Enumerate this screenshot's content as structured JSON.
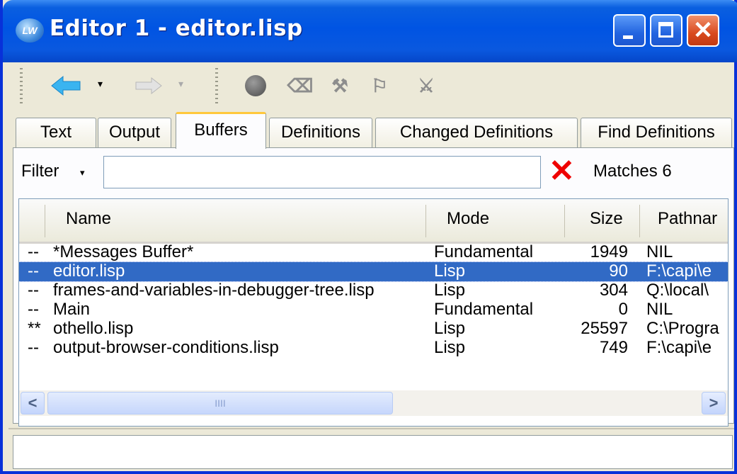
{
  "window": {
    "title": "Editor 1 - editor.lisp",
    "app_icon": "LW",
    "controls": [
      "minimize-icon",
      "maximize-icon",
      "close-icon"
    ]
  },
  "toolbar": {
    "back_icon": "⇦",
    "forward_icon": "⇨",
    "dropdown_glyph": "▾",
    "tool2": "⌫",
    "tool3": "⚒",
    "tool4": "⚐",
    "tool5": "⚔"
  },
  "tabs": [
    {
      "label": "Text"
    },
    {
      "label": "Output"
    },
    {
      "label": "Buffers",
      "active": true
    },
    {
      "label": "Definitions"
    },
    {
      "label": "Changed Definitions"
    },
    {
      "label": "Find Definitions"
    }
  ],
  "filter": {
    "label": "Filter",
    "caret": "▾",
    "value": "",
    "clear_glyph": "✕",
    "matches": "Matches 6"
  },
  "columns": [
    "Name",
    "Mode",
    "Size",
    "Pathnar"
  ],
  "rows": [
    {
      "flag": "--",
      "name": "*Messages Buffer*",
      "mode": "Fundamental",
      "size": "1949",
      "path": "NIL"
    },
    {
      "flag": "--",
      "name": "editor.lisp",
      "mode": "Lisp",
      "size": "90",
      "path": "F:\\capi\\e"
    },
    {
      "flag": "--",
      "name": "frames-and-variables-in-debugger-tree.lisp",
      "mode": "Lisp",
      "size": "304",
      "path": "Q:\\local\\"
    },
    {
      "flag": "--",
      "name": "Main",
      "mode": "Fundamental",
      "size": "0",
      "path": "NIL"
    },
    {
      "flag": "**",
      "name": "othello.lisp",
      "mode": "Lisp",
      "size": "25597",
      "path": "C:\\Progra"
    },
    {
      "flag": "--",
      "name": "output-browser-conditions.lisp",
      "mode": "Lisp",
      "size": "749",
      "path": "F:\\capi\\e"
    }
  ],
  "selected_row": 1,
  "scrollbar": {
    "left": "<",
    "right": ">",
    "grip": "IIII"
  },
  "status": {
    "text": ""
  },
  "colors": {
    "titlebar": "#0054e3",
    "selection": "#316ac5",
    "active_tab_accent": "#ffc83c",
    "close_button": "#d94a1e"
  }
}
